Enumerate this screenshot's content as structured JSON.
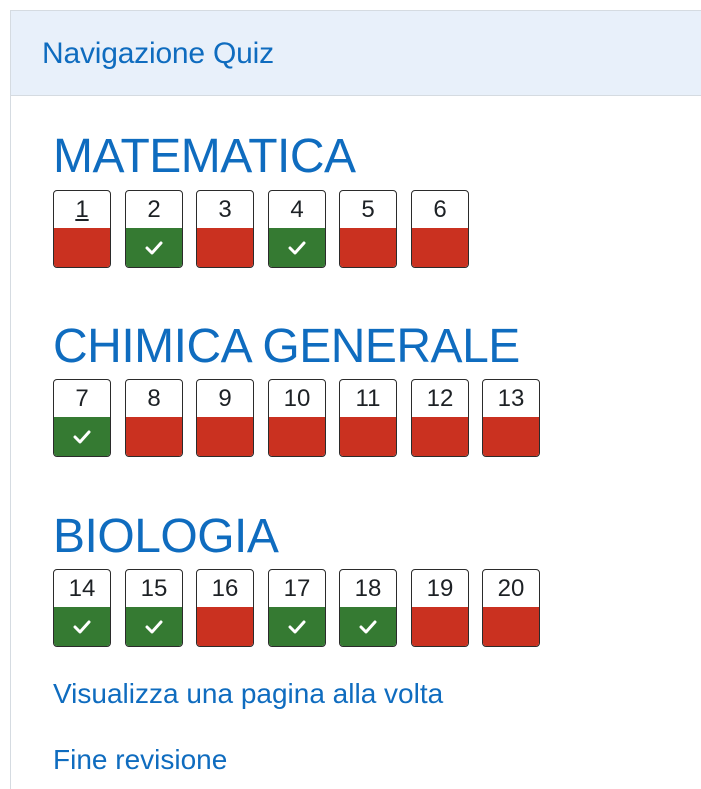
{
  "panel": {
    "title": "Navigazione Quiz"
  },
  "sections": [
    {
      "title": "MATEMATICA",
      "questions": [
        {
          "label": "1",
          "state": "incorrect",
          "current": true
        },
        {
          "label": "2",
          "state": "correct"
        },
        {
          "label": "3",
          "state": "incorrect"
        },
        {
          "label": "4",
          "state": "correct"
        },
        {
          "label": "5",
          "state": "incorrect"
        },
        {
          "label": "6",
          "state": "incorrect"
        }
      ]
    },
    {
      "title": "CHIMICA GENERALE",
      "questions": [
        {
          "label": "7",
          "state": "correct"
        },
        {
          "label": "8",
          "state": "incorrect"
        },
        {
          "label": "9",
          "state": "incorrect"
        },
        {
          "label": "10",
          "state": "incorrect"
        },
        {
          "label": "11",
          "state": "incorrect"
        },
        {
          "label": "12",
          "state": "incorrect"
        },
        {
          "label": "13",
          "state": "incorrect"
        }
      ]
    },
    {
      "title": "BIOLOGIA",
      "questions": [
        {
          "label": "14",
          "state": "correct"
        },
        {
          "label": "15",
          "state": "correct"
        },
        {
          "label": "16",
          "state": "incorrect"
        },
        {
          "label": "17",
          "state": "correct"
        },
        {
          "label": "18",
          "state": "correct"
        },
        {
          "label": "19",
          "state": "incorrect"
        },
        {
          "label": "20",
          "state": "incorrect"
        }
      ]
    }
  ],
  "links": {
    "one_page": "Visualizza una pagina alla volta",
    "finish_review": "Fine revisione"
  },
  "colors": {
    "correct": "#357a32",
    "incorrect": "#ca3120",
    "link": "#0f6cbf",
    "header_bg": "#e8f0fa"
  },
  "icons": {
    "correct_mark": "check-icon"
  }
}
